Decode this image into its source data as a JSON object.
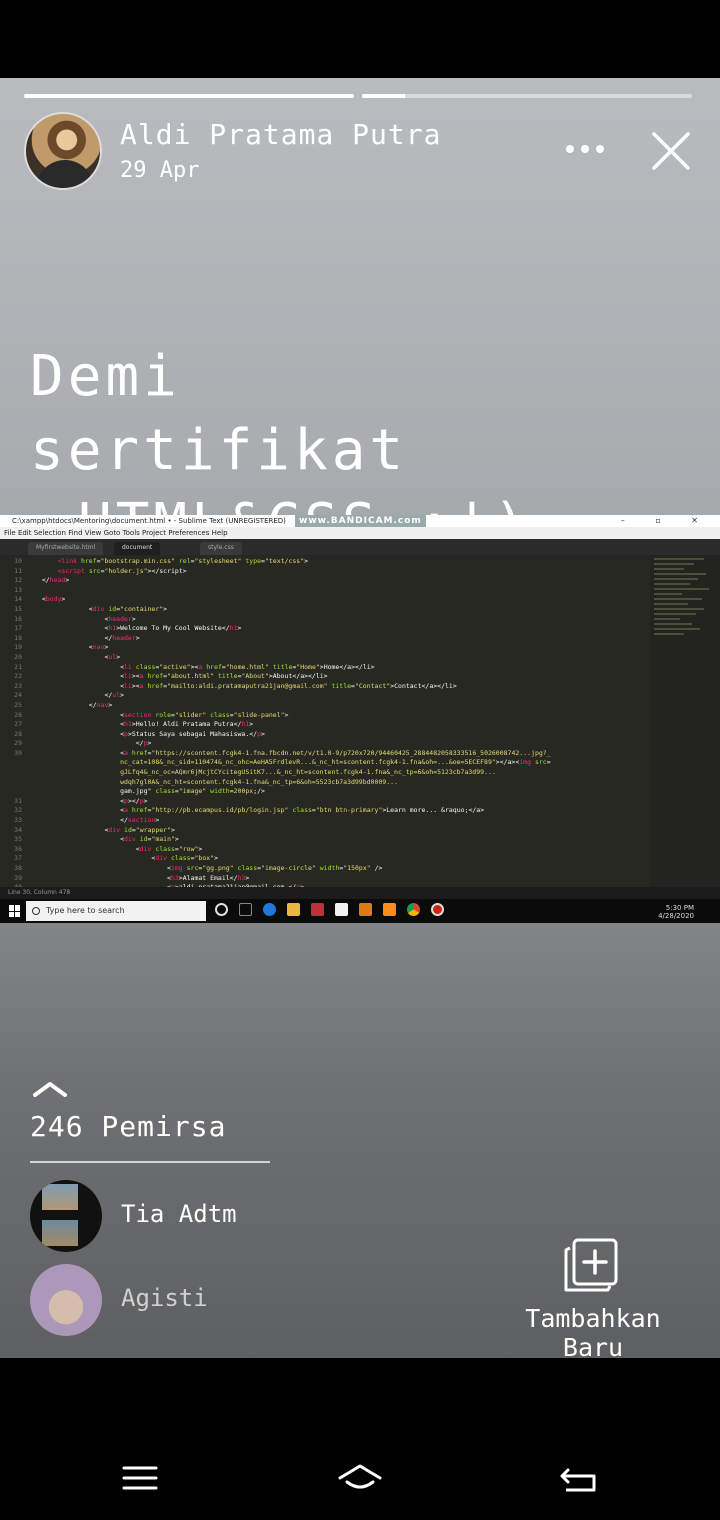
{
  "story": {
    "progress": [
      1.0,
      0.13
    ],
    "user_name": "Aldi Pratama Putra",
    "date": "29 Apr",
    "caption_line1": "Demi sertifikat",
    "caption_line2": "HTML&CSS :')"
  },
  "screenshot": {
    "window_title": "C:\\xampp\\htdocs\\Mentoring\\document.html • - Sublime Text (UNREGISTERED)",
    "watermark": "www.BANDICAM.com",
    "menu": "File  Edit  Selection  Find  View  Goto  Tools  Project  Preferences  Help",
    "tabs": [
      "Myfirstwebsite.html",
      "document",
      "style.css"
    ],
    "line_numbers": "10\n11\n12\n13\n14\n15\n16\n17\n18\n19\n20\n21\n22\n23\n24\n25\n26\n27\n28\n29\n30\n\n\n\n\n31\n32\n33\n34\n35\n36\n37\n38\n39\n40",
    "status_line": "Line 30, Column 478",
    "search_placeholder": "Type here to search",
    "clock_time": "5:30 PM",
    "clock_date": "4/28/2020"
  },
  "viewers": {
    "count_label": "246 Pemirsa",
    "list": [
      {
        "name": "Tia Adtm"
      },
      {
        "name": "Agisti"
      }
    ]
  },
  "add_new_label": "Tambahkan Baru",
  "icons": {
    "more": "more-icon",
    "close": "close-icon",
    "chevron": "chevron-up-icon",
    "add": "add-story-icon",
    "menu": "menu-icon",
    "home": "home-icon",
    "back": "back-icon"
  }
}
